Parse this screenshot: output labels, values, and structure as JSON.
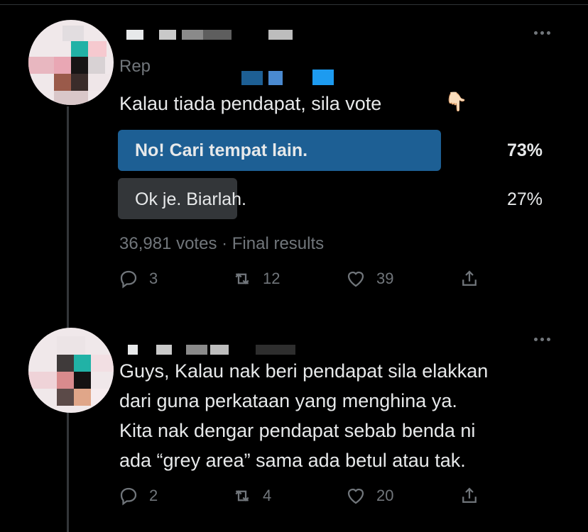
{
  "tweet1": {
    "replying_prefix": "Rep",
    "text": "Kalau tiada pendapat, sila vote",
    "emoji": "👇🏻",
    "poll": {
      "options": [
        {
          "label": "No! Cari tempat lain.",
          "percent": "73%",
          "share": 0.73,
          "winner": true
        },
        {
          "label": "Ok je. Biarlah.",
          "percent": "27%",
          "share": 0.27,
          "winner": false
        }
      ],
      "meta": "36,981 votes · Final results"
    },
    "actions": {
      "replies": "3",
      "retweets": "12",
      "likes": "39"
    }
  },
  "tweet2": {
    "lines": [
      "Guys, Kalau nak beri pendapat sila elakkan",
      "dari guna perkataan yang menghina ya.",
      "Kita nak dengar pendapat sebab benda ni",
      "ada “grey area” sama ada betul atau tak."
    ],
    "actions": {
      "replies": "2",
      "retweets": "4",
      "likes": "20"
    }
  },
  "colors": {
    "poll_winner": "#1d5f94",
    "poll_loser": "#333639",
    "muted": "#71767b",
    "text": "#e7e9ea"
  }
}
